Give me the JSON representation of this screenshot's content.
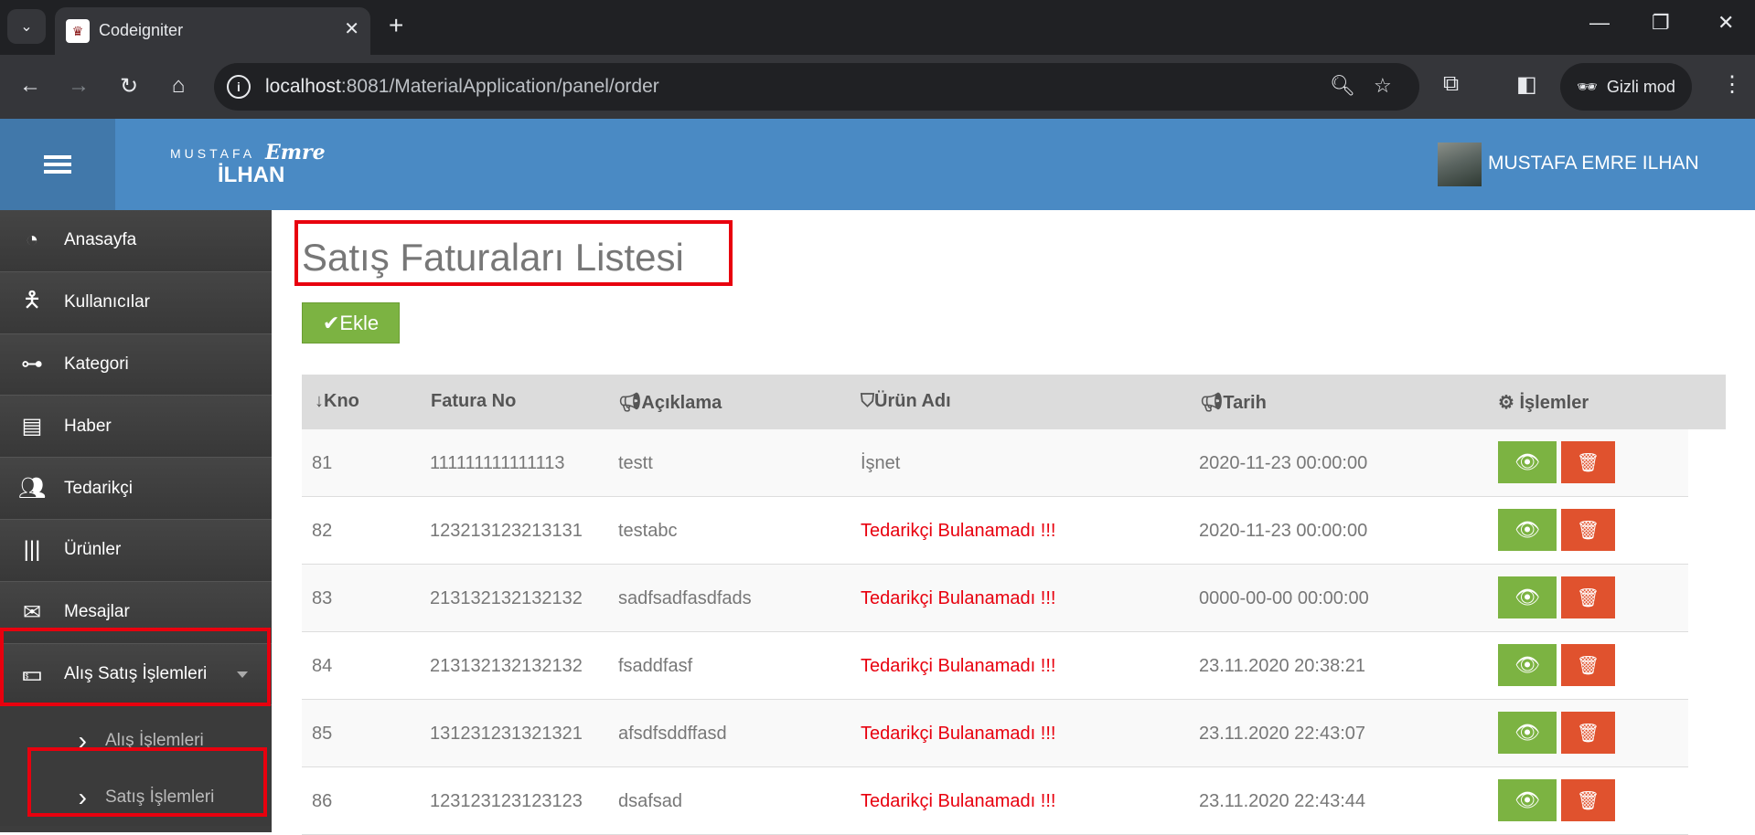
{
  "browser": {
    "tab_title": "Codeigniter",
    "url_host": "localhost",
    "url_rest": ":8081/MaterialApplication/panel/order",
    "incognito_label": "Gizli mod"
  },
  "header": {
    "logo_top": "MUSTAFA",
    "logo_script": "Emre",
    "logo_bottom": "İLHAN",
    "user_name": "MUSTAFA EMRE ILHAN"
  },
  "sidebar": {
    "items": [
      {
        "label": "Anasayfa",
        "icon": "dashboard-icon"
      },
      {
        "label": "Kullanıcılar",
        "icon": "user-icon"
      },
      {
        "label": "Kategori",
        "icon": "sitemap-icon"
      },
      {
        "label": "Haber",
        "icon": "book-icon"
      },
      {
        "label": "Tedarikçi",
        "icon": "users-icon"
      },
      {
        "label": "Ürünler",
        "icon": "barcode-icon"
      },
      {
        "label": "Mesajlar",
        "icon": "envelope-icon"
      },
      {
        "label": "Alış Satış İşlemleri",
        "icon": "money-icon"
      }
    ],
    "sub_items": [
      {
        "label": "Alış İşlemleri"
      },
      {
        "label": "Satış İşlemleri"
      }
    ]
  },
  "main": {
    "page_title": "Satış Faturaları Listesi",
    "add_label": "Ekle",
    "columns": [
      "Kno",
      "Fatura No",
      "Açıklama",
      "Ürün Adı",
      "Tarih",
      "İşlemler"
    ],
    "rows": [
      {
        "kno": "81",
        "fatura": "111111111111113",
        "aciklama": "testt",
        "urun": "İşnet",
        "tarih": "2020-11-23 00:00:00",
        "error": false
      },
      {
        "kno": "82",
        "fatura": "123213123213131",
        "aciklama": "testabc",
        "urun": "Tedarikçi Bulanamadı !!!",
        "tarih": "2020-11-23 00:00:00",
        "error": true
      },
      {
        "kno": "83",
        "fatura": "213132132132132",
        "aciklama": "sadfsadfasdfads",
        "urun": "Tedarikçi Bulanamadı !!!",
        "tarih": "0000-00-00 00:00:00",
        "error": true
      },
      {
        "kno": "84",
        "fatura": "213132132132132",
        "aciklama": "fsaddfasf",
        "urun": "Tedarikçi Bulanamadı !!!",
        "tarih": "23.11.2020 20:38:21",
        "error": true
      },
      {
        "kno": "85",
        "fatura": "131231231321321",
        "aciklama": "afsdfsddffasd",
        "urun": "Tedarikçi Bulanamadı !!!",
        "tarih": "23.11.2020 22:43:07",
        "error": true
      },
      {
        "kno": "86",
        "fatura": "123123123123123",
        "aciklama": "dsafsad",
        "urun": "Tedarikçi Bulanamadı !!!",
        "tarih": "23.11.2020 22:43:44",
        "error": true
      }
    ]
  },
  "colors": {
    "header_blue": "#4a8ac4",
    "sidebar_dark": "#3d3d3d",
    "success_green": "#7cb342",
    "danger_orange": "#e0522e",
    "error_red": "#e8000e"
  }
}
